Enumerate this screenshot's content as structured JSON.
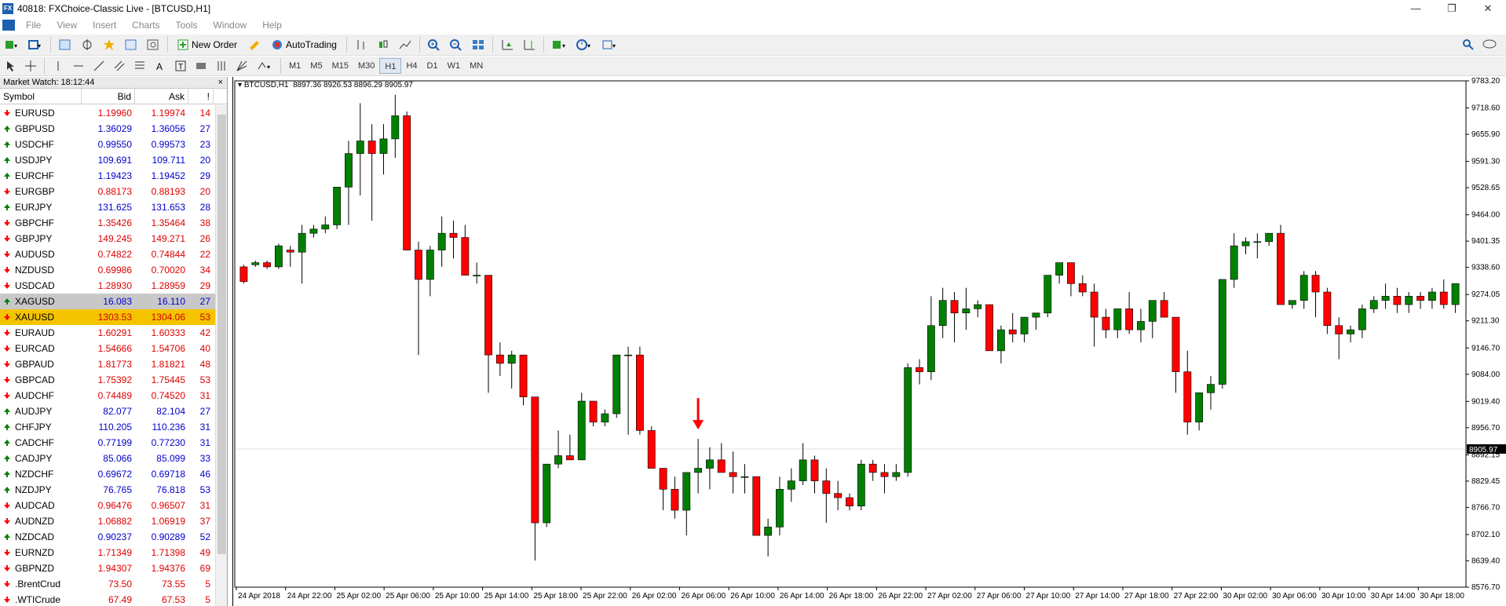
{
  "window": {
    "title": "40818: FXChoice-Classic Live - [BTCUSD,H1]",
    "app_icon": "FX"
  },
  "window_controls": {
    "minimize": "—",
    "restore": "❐",
    "close": "✕"
  },
  "menu": [
    "File",
    "View",
    "Insert",
    "Charts",
    "Tools",
    "Window",
    "Help"
  ],
  "toolbar": {
    "new_order": "New Order",
    "autotrading": "AutoTrading"
  },
  "timeframes": [
    "M1",
    "M5",
    "M15",
    "M30",
    "H1",
    "H4",
    "D1",
    "W1",
    "MN"
  ],
  "active_timeframe": "H1",
  "market_watch": {
    "title": "Market Watch: 18:12:44",
    "close": "×",
    "columns": {
      "symbol": "Symbol",
      "bid": "Bid",
      "ask": "Ask",
      "spread": "!"
    },
    "rows": [
      {
        "symbol": "EURUSD",
        "bid": "1.19960",
        "ask": "1.19974",
        "spread": "14",
        "dir": "down"
      },
      {
        "symbol": "GBPUSD",
        "bid": "1.36029",
        "ask": "1.36056",
        "spread": "27",
        "dir": "up"
      },
      {
        "symbol": "USDCHF",
        "bid": "0.99550",
        "ask": "0.99573",
        "spread": "23",
        "dir": "up"
      },
      {
        "symbol": "USDJPY",
        "bid": "109.691",
        "ask": "109.711",
        "spread": "20",
        "dir": "up"
      },
      {
        "symbol": "EURCHF",
        "bid": "1.19423",
        "ask": "1.19452",
        "spread": "29",
        "dir": "up"
      },
      {
        "symbol": "EURGBP",
        "bid": "0.88173",
        "ask": "0.88193",
        "spread": "20",
        "dir": "down"
      },
      {
        "symbol": "EURJPY",
        "bid": "131.625",
        "ask": "131.653",
        "spread": "28",
        "dir": "up"
      },
      {
        "symbol": "GBPCHF",
        "bid": "1.35426",
        "ask": "1.35464",
        "spread": "38",
        "dir": "down"
      },
      {
        "symbol": "GBPJPY",
        "bid": "149.245",
        "ask": "149.271",
        "spread": "26",
        "dir": "down"
      },
      {
        "symbol": "AUDUSD",
        "bid": "0.74822",
        "ask": "0.74844",
        "spread": "22",
        "dir": "down"
      },
      {
        "symbol": "NZDUSD",
        "bid": "0.69986",
        "ask": "0.70020",
        "spread": "34",
        "dir": "down"
      },
      {
        "symbol": "USDCAD",
        "bid": "1.28930",
        "ask": "1.28959",
        "spread": "29",
        "dir": "down"
      },
      {
        "symbol": "XAGUSD",
        "bid": "16.083",
        "ask": "16.110",
        "spread": "27",
        "dir": "up",
        "state": "sel"
      },
      {
        "symbol": "XAUUSD",
        "bid": "1303.53",
        "ask": "1304.06",
        "spread": "53",
        "dir": "down",
        "state": "hl"
      },
      {
        "symbol": "EURAUD",
        "bid": "1.60291",
        "ask": "1.60333",
        "spread": "42",
        "dir": "down"
      },
      {
        "symbol": "EURCAD",
        "bid": "1.54666",
        "ask": "1.54706",
        "spread": "40",
        "dir": "down"
      },
      {
        "symbol": "GBPAUD",
        "bid": "1.81773",
        "ask": "1.81821",
        "spread": "48",
        "dir": "down"
      },
      {
        "symbol": "GBPCAD",
        "bid": "1.75392",
        "ask": "1.75445",
        "spread": "53",
        "dir": "down"
      },
      {
        "symbol": "AUDCHF",
        "bid": "0.74489",
        "ask": "0.74520",
        "spread": "31",
        "dir": "down"
      },
      {
        "symbol": "AUDJPY",
        "bid": "82.077",
        "ask": "82.104",
        "spread": "27",
        "dir": "up"
      },
      {
        "symbol": "CHFJPY",
        "bid": "110.205",
        "ask": "110.236",
        "spread": "31",
        "dir": "up"
      },
      {
        "symbol": "CADCHF",
        "bid": "0.77199",
        "ask": "0.77230",
        "spread": "31",
        "dir": "up"
      },
      {
        "symbol": "CADJPY",
        "bid": "85.066",
        "ask": "85.099",
        "spread": "33",
        "dir": "up"
      },
      {
        "symbol": "NZDCHF",
        "bid": "0.69672",
        "ask": "0.69718",
        "spread": "46",
        "dir": "up"
      },
      {
        "symbol": "NZDJPY",
        "bid": "76.765",
        "ask": "76.818",
        "spread": "53",
        "dir": "up"
      },
      {
        "symbol": "AUDCAD",
        "bid": "0.96476",
        "ask": "0.96507",
        "spread": "31",
        "dir": "down"
      },
      {
        "symbol": "AUDNZD",
        "bid": "1.06882",
        "ask": "1.06919",
        "spread": "37",
        "dir": "down"
      },
      {
        "symbol": "NZDCAD",
        "bid": "0.90237",
        "ask": "0.90289",
        "spread": "52",
        "dir": "up"
      },
      {
        "symbol": "EURNZD",
        "bid": "1.71349",
        "ask": "1.71398",
        "spread": "49",
        "dir": "down"
      },
      {
        "symbol": "GBPNZD",
        "bid": "1.94307",
        "ask": "1.94376",
        "spread": "69",
        "dir": "down"
      },
      {
        "symbol": ".BrentCrud",
        "bid": "73.50",
        "ask": "73.55",
        "spread": "5",
        "dir": "down"
      },
      {
        "symbol": ".WTICrude",
        "bid": "67.49",
        "ask": "67.53",
        "spread": "5",
        "dir": "down"
      }
    ]
  },
  "colors": {
    "bull": "#008000",
    "bear": "#ff0000",
    "highlight": "#f5c400",
    "bid_up": "#0000cc",
    "bid_down": "#e00000",
    "annotation_arrow": "#ff0000"
  },
  "chart_data": {
    "type": "candlestick",
    "symbol_label": "BTCUSD,H1",
    "ohlc_label": "8897.36 8926.53 8896.29 8905.97",
    "current_price": "8905.97",
    "price_ticks": [
      "9783.20",
      "9718.60",
      "9655.90",
      "9591.30",
      "9528.65",
      "9464.00",
      "9401.35",
      "9338.60",
      "9274.05",
      "9211.30",
      "9146.70",
      "9084.00",
      "9019.40",
      "8956.70",
      "8892.15",
      "8829.45",
      "8766.70",
      "8702.10",
      "8639.40",
      "8576.70"
    ],
    "time_labels": [
      "24 Apr 2018",
      "24 Apr 22:00",
      "25 Apr 02:00",
      "25 Apr 06:00",
      "25 Apr 10:00",
      "25 Apr 14:00",
      "25 Apr 18:00",
      "25 Apr 22:00",
      "26 Apr 02:00",
      "26 Apr 06:00",
      "26 Apr 10:00",
      "26 Apr 14:00",
      "26 Apr 18:00",
      "26 Apr 22:00",
      "27 Apr 02:00",
      "27 Apr 06:00",
      "27 Apr 10:00",
      "27 Apr 14:00",
      "27 Apr 18:00",
      "27 Apr 22:00",
      "30 Apr 02:00",
      "30 Apr 06:00",
      "30 Apr 10:00",
      "30 Apr 14:00",
      "30 Apr 18:00"
    ],
    "y_range": [
      8576.7,
      9783.2
    ],
    "annotation": {
      "type": "down-arrow",
      "candle_index": 39
    },
    "candles": [
      [
        9340,
        9345,
        9300,
        9305
      ],
      [
        9345,
        9355,
        9340,
        9350
      ],
      [
        9350,
        9355,
        9335,
        9340
      ],
      [
        9340,
        9395,
        9335,
        9390
      ],
      [
        9380,
        9390,
        9340,
        9375
      ],
      [
        9375,
        9440,
        9300,
        9420
      ],
      [
        9420,
        9440,
        9410,
        9430
      ],
      [
        9430,
        9460,
        9420,
        9440
      ],
      [
        9440,
        9530,
        9430,
        9530
      ],
      [
        9530,
        9640,
        9440,
        9610
      ],
      [
        9610,
        9730,
        9510,
        9640
      ],
      [
        9640,
        9680,
        9450,
        9610
      ],
      [
        9610,
        9680,
        9560,
        9645
      ],
      [
        9645,
        9750,
        9600,
        9700
      ],
      [
        9700,
        9710,
        9380,
        9380
      ],
      [
        9380,
        9400,
        9130,
        9310
      ],
      [
        9310,
        9390,
        9270,
        9380
      ],
      [
        9380,
        9460,
        9340,
        9420
      ],
      [
        9420,
        9450,
        9360,
        9410
      ],
      [
        9410,
        9440,
        9330,
        9320
      ],
      [
        9320,
        9350,
        9300,
        9320
      ],
      [
        9320,
        9320,
        9040,
        9130
      ],
      [
        9130,
        9160,
        9080,
        9110
      ],
      [
        9110,
        9140,
        9050,
        9130
      ],
      [
        9130,
        9130,
        9010,
        9030
      ],
      [
        9030,
        9030,
        8640,
        8730
      ],
      [
        8730,
        8860,
        8720,
        8870
      ],
      [
        8870,
        8950,
        8860,
        8890
      ],
      [
        8890,
        8940,
        8880,
        8880
      ],
      [
        8880,
        9040,
        8880,
        9020
      ],
      [
        9020,
        9020,
        8960,
        8970
      ],
      [
        8970,
        9000,
        8960,
        8990
      ],
      [
        8990,
        9100,
        8980,
        9130
      ],
      [
        9130,
        9150,
        8940,
        9130
      ],
      [
        9130,
        9150,
        8940,
        8950
      ],
      [
        8950,
        8960,
        8860,
        8860
      ],
      [
        8860,
        8860,
        8760,
        8810
      ],
      [
        8810,
        8840,
        8740,
        8760
      ],
      [
        8760,
        8840,
        8700,
        8850
      ],
      [
        8850,
        8930,
        8800,
        8860
      ],
      [
        8860,
        8910,
        8810,
        8880
      ],
      [
        8880,
        8920,
        8850,
        8850
      ],
      [
        8850,
        8900,
        8800,
        8840
      ],
      [
        8840,
        8870,
        8800,
        8840
      ],
      [
        8840,
        8840,
        8710,
        8700
      ],
      [
        8700,
        8740,
        8650,
        8720
      ],
      [
        8720,
        8840,
        8700,
        8810
      ],
      [
        8810,
        8860,
        8780,
        8830
      ],
      [
        8830,
        8920,
        8820,
        8880
      ],
      [
        8880,
        8890,
        8800,
        8830
      ],
      [
        8830,
        8860,
        8730,
        8800
      ],
      [
        8800,
        8830,
        8760,
        8790
      ],
      [
        8790,
        8800,
        8760,
        8770
      ],
      [
        8770,
        8880,
        8760,
        8870
      ],
      [
        8870,
        8880,
        8830,
        8850
      ],
      [
        8850,
        8870,
        8800,
        8840
      ],
      [
        8840,
        8870,
        8830,
        8850
      ],
      [
        8850,
        9110,
        8840,
        9100
      ],
      [
        9100,
        9120,
        9060,
        9090
      ],
      [
        9090,
        9270,
        9070,
        9200
      ],
      [
        9200,
        9290,
        9170,
        9260
      ],
      [
        9260,
        9280,
        9160,
        9230
      ],
      [
        9230,
        9290,
        9190,
        9240
      ],
      [
        9240,
        9260,
        9220,
        9250
      ],
      [
        9250,
        9250,
        9140,
        9140
      ],
      [
        9140,
        9200,
        9110,
        9190
      ],
      [
        9190,
        9230,
        9160,
        9180
      ],
      [
        9180,
        9210,
        9160,
        9220
      ],
      [
        9220,
        9230,
        9190,
        9230
      ],
      [
        9230,
        9320,
        9220,
        9320
      ],
      [
        9320,
        9350,
        9300,
        9350
      ],
      [
        9350,
        9350,
        9270,
        9300
      ],
      [
        9300,
        9320,
        9270,
        9280
      ],
      [
        9280,
        9300,
        9150,
        9220
      ],
      [
        9220,
        9240,
        9170,
        9190
      ],
      [
        9190,
        9240,
        9170,
        9240
      ],
      [
        9240,
        9280,
        9180,
        9190
      ],
      [
        9190,
        9240,
        9160,
        9210
      ],
      [
        9210,
        9250,
        9170,
        9260
      ],
      [
        9260,
        9280,
        9220,
        9220
      ],
      [
        9220,
        9220,
        9040,
        9090
      ],
      [
        9090,
        9140,
        8940,
        8970
      ],
      [
        8970,
        8980,
        8950,
        9040
      ],
      [
        9040,
        9080,
        9000,
        9060
      ],
      [
        9060,
        9300,
        9050,
        9310
      ],
      [
        9310,
        9420,
        9290,
        9390
      ],
      [
        9390,
        9410,
        9370,
        9400
      ],
      [
        9400,
        9420,
        9360,
        9400
      ],
      [
        9400,
        9400,
        9390,
        9420
      ],
      [
        9420,
        9440,
        9250,
        9250
      ],
      [
        9250,
        9260,
        9240,
        9260
      ],
      [
        9260,
        9330,
        9240,
        9320
      ],
      [
        9320,
        9330,
        9220,
        9280
      ],
      [
        9280,
        9290,
        9180,
        9200
      ],
      [
        9200,
        9220,
        9120,
        9180
      ],
      [
        9180,
        9200,
        9160,
        9190
      ],
      [
        9190,
        9250,
        9170,
        9240
      ],
      [
        9240,
        9270,
        9230,
        9260
      ],
      [
        9260,
        9300,
        9240,
        9270
      ],
      [
        9270,
        9290,
        9230,
        9250
      ],
      [
        9250,
        9280,
        9230,
        9270
      ],
      [
        9270,
        9280,
        9240,
        9260
      ],
      [
        9260,
        9290,
        9240,
        9280
      ],
      [
        9280,
        9310,
        9240,
        9250
      ],
      [
        9250,
        9300,
        9230,
        9300
      ]
    ]
  }
}
